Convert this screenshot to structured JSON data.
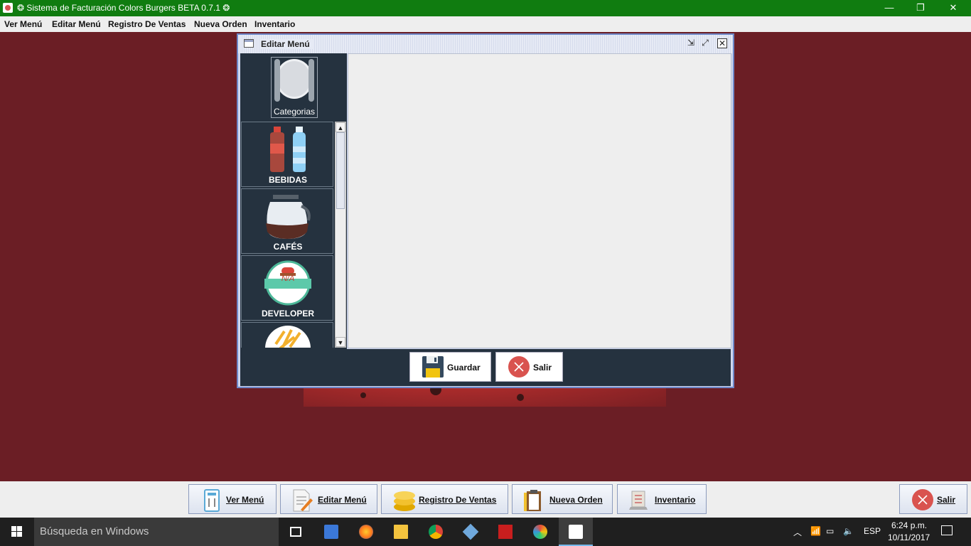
{
  "titlebar": {
    "title": "❂ Sistema de Facturación Colors Burgers BETA 0.7.1 ❂",
    "minimize": "—",
    "maximize": "❐",
    "close": "✕"
  },
  "menubar": {
    "items": [
      "Ver Menú",
      "Editar Menú",
      "Registro De Ventas",
      "Nueva Orden",
      "Inventario"
    ]
  },
  "dialog": {
    "title": "Editar Menú",
    "categories_label": "Categorias",
    "items": [
      {
        "label": "BEBIDAS",
        "icon": "bottles-icon"
      },
      {
        "label": "CAFÉS",
        "icon": "coffee-pot-icon"
      },
      {
        "label": "DEVELOPER",
        "icon": "na-badge-icon",
        "badge": "N/A"
      },
      {
        "label": "",
        "icon": "fries-icon"
      }
    ],
    "save_label": "Guardar",
    "exit_label": "Salir"
  },
  "toolbar": {
    "buttons": [
      {
        "label": "Ver Menú",
        "icon": "menu-card-icon"
      },
      {
        "label": "Editar Menú",
        "icon": "edit-document-icon"
      },
      {
        "label": "Registro De Ventas",
        "icon": "coins-icon"
      },
      {
        "label": "Nueva Orden",
        "icon": "clipboard-icon"
      },
      {
        "label": "Inventario",
        "icon": "inventory-icon"
      }
    ],
    "exit_label": "Salir"
  },
  "taskbar": {
    "search_placeholder": "Búsqueda en Windows",
    "language": "ESP",
    "time": "6:24 p.m.",
    "date": "10/11/2017"
  },
  "colors": {
    "titlebar": "#107c10",
    "background": "#6b1e25",
    "panel": "#25323f",
    "exit_red": "#d9534f"
  }
}
